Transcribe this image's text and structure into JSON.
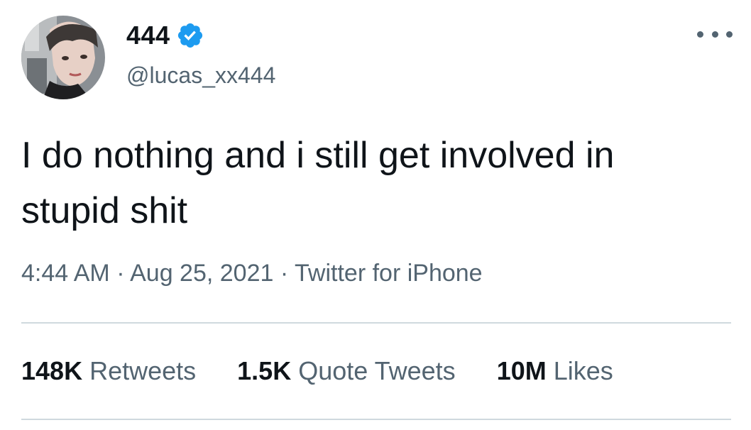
{
  "author": {
    "display_name": "444",
    "handle": "@lucas_xx444",
    "verified": true
  },
  "tweet": {
    "text_line1": "I do nothing and i still get involved in",
    "text_line2": "stupid shit",
    "time": "4:44 AM",
    "date": "Aug 25, 2021",
    "source": "Twitter for iPhone",
    "separator": "·"
  },
  "stats": [
    {
      "count": "148K",
      "label": "Retweets"
    },
    {
      "count": "1.5K",
      "label": "Quote Tweets"
    },
    {
      "count": "10M",
      "label": "Likes"
    }
  ],
  "colors": {
    "verified_badge": "#1d9bf0",
    "text_primary": "#0f1419",
    "text_secondary": "#536471",
    "divider": "#cfd9de"
  },
  "icons": {
    "verified": "verified-badge-icon",
    "more": "more-options-icon"
  }
}
